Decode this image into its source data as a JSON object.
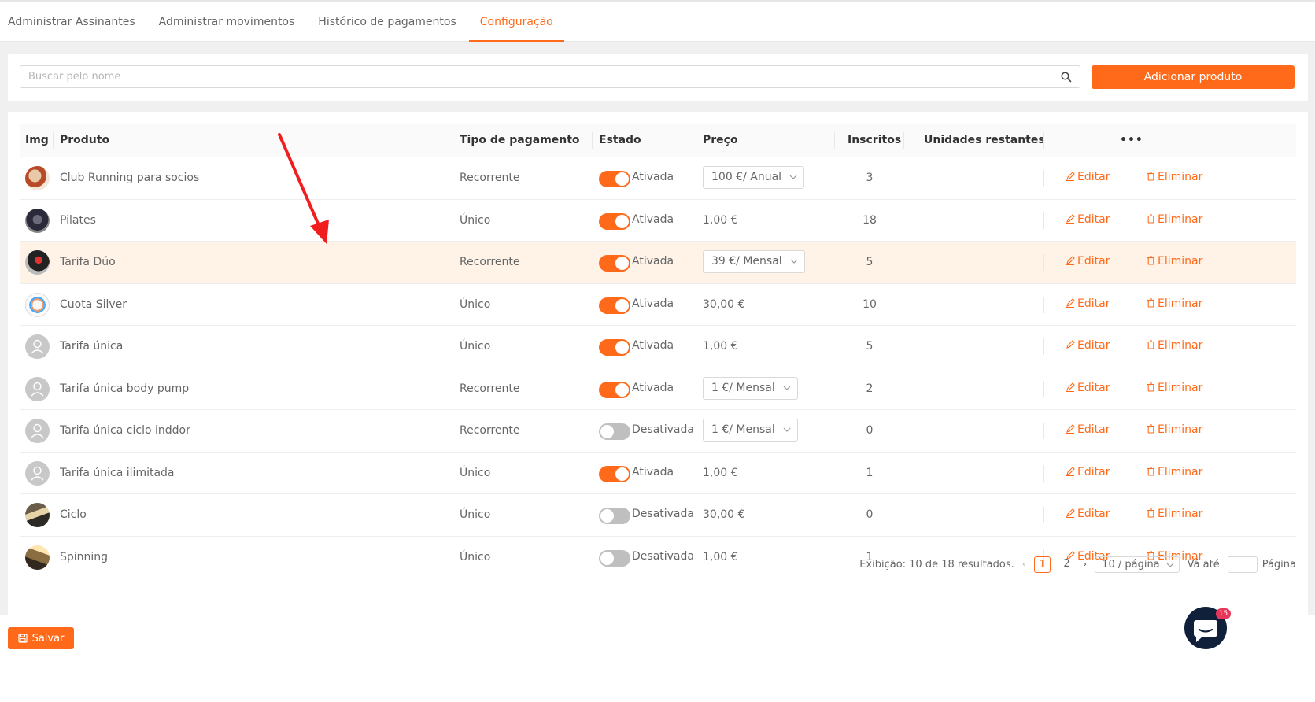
{
  "tabs": [
    {
      "label": "Administrar Assinantes",
      "active": false
    },
    {
      "label": "Administrar movimentos",
      "active": false
    },
    {
      "label": "Histórico de pagamentos",
      "active": false
    },
    {
      "label": "Configuração",
      "active": true
    }
  ],
  "search": {
    "placeholder": "Buscar pelo nome",
    "value": ""
  },
  "add_button_label": "Adicionar produto",
  "columns": {
    "img": "Img",
    "produto": "Produto",
    "tipo": "Tipo de pagamento",
    "estado": "Estado",
    "preco": "Preço",
    "inscritos": "Inscritos",
    "unidades": "Unidades restantes",
    "more": "•••"
  },
  "actions": {
    "edit": "Editar",
    "delete": "Eliminar"
  },
  "rows": [
    {
      "name": "Club Running para socios",
      "type": "Recorrente",
      "state": "Ativada",
      "on": true,
      "price": "100 €/ Anual",
      "price_select": true,
      "subs": "3",
      "avatar": "photo"
    },
    {
      "name": "Pilates",
      "type": "Único",
      "state": "Ativada",
      "on": true,
      "price": "1,00 €",
      "price_select": false,
      "subs": "18",
      "avatar": "photo"
    },
    {
      "name": "Tarifa Dúo",
      "type": "Recorrente",
      "state": "Ativada",
      "on": true,
      "price": "39 €/ Mensal",
      "price_select": true,
      "subs": "5",
      "avatar": "photo",
      "highlight": true
    },
    {
      "name": "Cuota Silver",
      "type": "Único",
      "state": "Ativada",
      "on": true,
      "price": "30,00 €",
      "price_select": false,
      "subs": "10",
      "avatar": "photo"
    },
    {
      "name": "Tarifa única",
      "type": "Único",
      "state": "Ativada",
      "on": true,
      "price": "1,00 €",
      "price_select": false,
      "subs": "5",
      "avatar": "user-icon"
    },
    {
      "name": "Tarifa única body pump",
      "type": "Recorrente",
      "state": "Ativada",
      "on": true,
      "price": "1 €/ Mensal",
      "price_select": true,
      "subs": "2",
      "avatar": "user-icon"
    },
    {
      "name": "Tarifa única ciclo inddor",
      "type": "Recorrente",
      "state": "Desativada",
      "on": false,
      "price": "1 €/ Mensal",
      "price_select": true,
      "subs": "0",
      "avatar": "user-icon"
    },
    {
      "name": "Tarifa única ilimitada",
      "type": "Único",
      "state": "Ativada",
      "on": true,
      "price": "1,00 €",
      "price_select": false,
      "subs": "1",
      "avatar": "user-icon"
    },
    {
      "name": "Ciclo",
      "type": "Único",
      "state": "Desativada",
      "on": false,
      "price": "30,00 €",
      "price_select": false,
      "subs": "0",
      "avatar": "photo"
    },
    {
      "name": "Spinning",
      "type": "Único",
      "state": "Desativada",
      "on": false,
      "price": "1,00 €",
      "price_select": false,
      "subs": "1",
      "avatar": "photo"
    }
  ],
  "pagination": {
    "summary": "Exibição: 10 de 18 resultados.",
    "pages": [
      "1",
      "2"
    ],
    "current": "1",
    "per_page": "10 / página",
    "goto_label": "Vá até",
    "page_label": "Página"
  },
  "save_label": "Salvar",
  "chat_badge": "15",
  "colors": {
    "accent": "#ff6a1a",
    "highlight_row": "#fff3e8",
    "chat": "#11203a",
    "badge": "#e8365a"
  }
}
